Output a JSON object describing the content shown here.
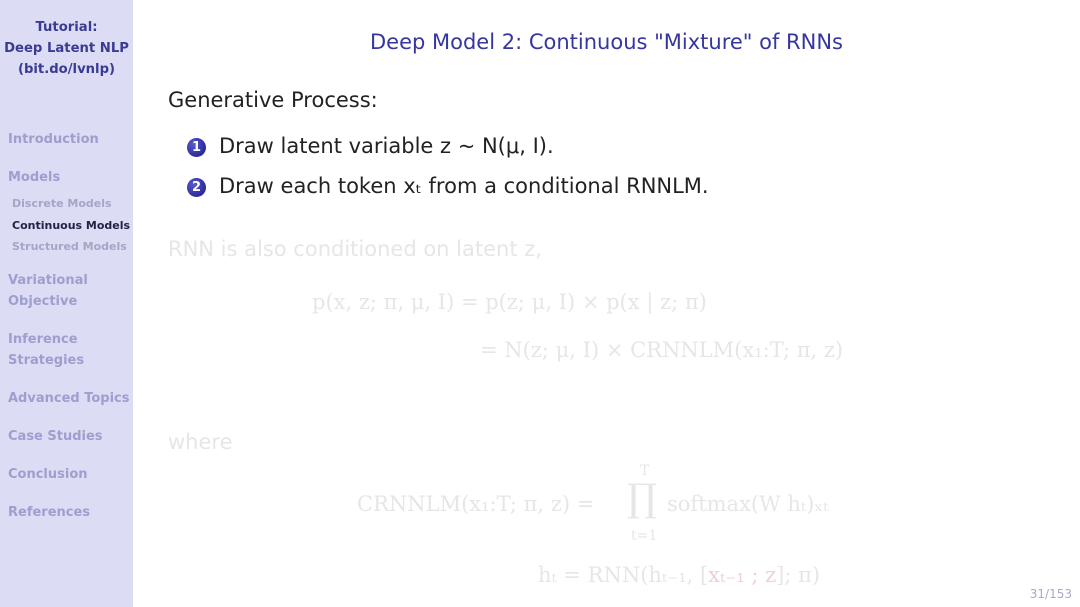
{
  "sidebar": {
    "title_lines": [
      "Tutorial:",
      "Deep Latent NLP",
      "(bit.do/lvnlp)"
    ],
    "sections": [
      {
        "label": "Introduction"
      },
      {
        "label": "Models"
      },
      {
        "label": "Variational\nObjective"
      },
      {
        "label": "Inference\nStrategies"
      },
      {
        "label": "Advanced Topics"
      },
      {
        "label": "Case Studies"
      },
      {
        "label": "Conclusion"
      },
      {
        "label": "References"
      }
    ],
    "subsections": [
      {
        "label": "Discrete Models",
        "active": false
      },
      {
        "label": "Continuous Models",
        "active": true
      },
      {
        "label": "Structured Models",
        "active": false
      }
    ]
  },
  "slide": {
    "title": "Deep Model 2: Continuous \"Mixture\" of RNNs",
    "heading": "Generative Process:",
    "steps": [
      {
        "number": "1",
        "text": "Draw latent variable z ~ N(μ, I)."
      },
      {
        "number": "2",
        "text": "Draw each token xₜ from a conditional RNNLM."
      }
    ],
    "faded": {
      "intro": "RNN is also conditioned on latent z,",
      "eq1_left": "p(x, z; π, μ, I) = p(z; μ, I) × p(x | z; π)",
      "eq1_right": "= N(z; μ, I) × CRNNLM(x₁:T; π, z)",
      "where": "where",
      "eq2_lhs": "CRNNLM(x₁:T; π, z) =",
      "eq2_prod_top": "T",
      "eq2_prod_bottom": "t=1",
      "eq2_rhs": "softmax(W hₜ)ₓₜ",
      "eq3_a": "hₜ = RNN(hₜ₋₁, [",
      "eq3_b": "xₜ₋₁ ; z",
      "eq3_c": "]; π)"
    },
    "page": "31/153"
  }
}
